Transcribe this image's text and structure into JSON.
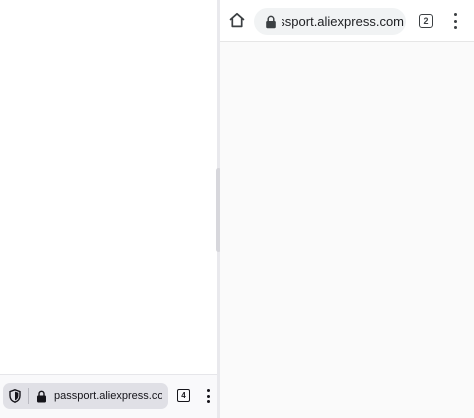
{
  "left_browser": {
    "icons": {
      "tracking_protection": "shield-icon",
      "security": "lock-icon",
      "menu": "more-vert-icon"
    },
    "url": "passport.aliexpress.com/ac",
    "tab_count": "4"
  },
  "right_browser": {
    "icons": {
      "home": "home-icon",
      "security": "lock-icon",
      "menu": "more-vert-icon"
    },
    "url": "passport.aliexpress.com",
    "tab_count": "2"
  },
  "colors": {
    "chrome_omnibox_bg": "#f1f3f4",
    "firefox_omnibox_bg": "#e0e0e6",
    "divider": "#e9e9ed"
  }
}
